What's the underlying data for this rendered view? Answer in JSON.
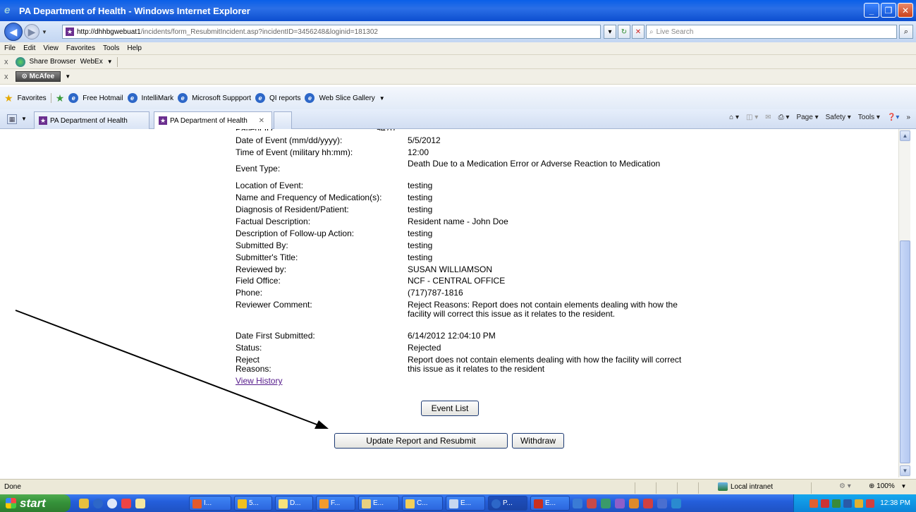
{
  "window": {
    "title": "PA Department of Health - Windows Internet Explorer"
  },
  "address": {
    "url_host": "http://dhhbgwebuat1",
    "url_rest": "/incidents/form_ResubmitIncident.asp?incidentID=3456248&loginid=181302",
    "search_placeholder": "Live Search"
  },
  "menu": [
    "File",
    "Edit",
    "View",
    "Favorites",
    "Tools",
    "Help"
  ],
  "toolbar1": {
    "share_browser": "Share Browser",
    "webex": "WebEx"
  },
  "toolbar2": {
    "mcafee": "McAfee"
  },
  "favorites": {
    "label": "Favorites",
    "links": [
      "Free Hotmail",
      "IntelliMark",
      "Microsoft Suppport",
      "QI reports",
      "Web Slice Gallery"
    ]
  },
  "tabs": [
    {
      "label": "PA Department of Health"
    },
    {
      "label": "PA Department of Health"
    }
  ],
  "commandbar": {
    "page": "Page",
    "safety": "Safety",
    "tools": "Tools"
  },
  "details": [
    {
      "label": "Date of Event (mm/dd/yyyy):",
      "value": "5/5/2012"
    },
    {
      "label": "Time of Event (military hh:mm):",
      "value": "12:00"
    },
    {
      "label": "Event Type:",
      "value": "Death Due to a Medication Error or Adverse Reaction to Medication"
    },
    {
      "label": "Location of Event:",
      "value": "testing"
    },
    {
      "label": "Name and Frequency of Medication(s):",
      "value": "testing"
    },
    {
      "label": "Diagnosis of Resident/Patient:",
      "value": "testing"
    },
    {
      "label": "Factual Description:",
      "value": "Resident name - John Doe"
    },
    {
      "label": "Description of Follow-up Action:",
      "value": "testing"
    },
    {
      "label": "Submitted By:",
      "value": "testing"
    },
    {
      "label": "Submitter's Title:",
      "value": "testing"
    },
    {
      "label": "Reviewed by:",
      "value": "SUSAN WILLIAMSON"
    },
    {
      "label": "Field Office:",
      "value": "NCF - CENTRAL OFFICE"
    },
    {
      "label": "Phone:",
      "value": "(717)787-1816"
    },
    {
      "label": "Reviewer Comment:",
      "value": "Reject Reasons: Report does not contain elements dealing with how the facility will correct this issue as it relates to the resident."
    },
    {
      "label": "Date First Submitted:",
      "value": "6/14/2012 12:04:10 PM"
    },
    {
      "label": "Status:",
      "value": "Rejected"
    },
    {
      "label": "Reject Reasons:",
      "value": "Report does not contain elements dealing with how the facility will correct this issue as it relates to the resident"
    }
  ],
  "links": {
    "view_history": "View History"
  },
  "buttons": {
    "event_list": "Event List",
    "update_resubmit": "Update Report and Resubmit",
    "withdraw": "Withdraw"
  },
  "status": {
    "text": "Done",
    "zone": "Local intranet",
    "zoom": "100%"
  },
  "taskbar": {
    "start": "start",
    "items": [
      "I...",
      "5...",
      "D...",
      "F...",
      "E...",
      "C...",
      "E...",
      "P...",
      "E..."
    ],
    "clock": "12:38 PM"
  },
  "colors": {
    "titlebar": "#0a5fe8",
    "link_visited": "#551a8b",
    "taskbar": "#245edb",
    "start": "#35923a"
  }
}
